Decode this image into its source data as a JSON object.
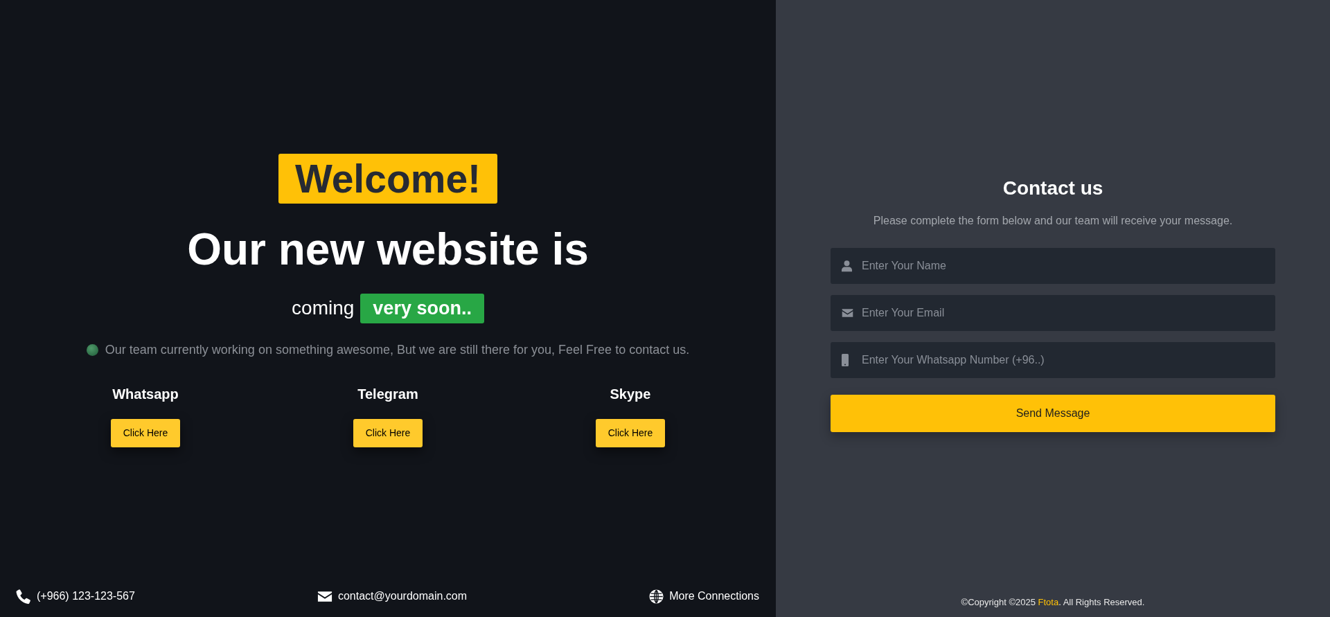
{
  "hero": {
    "badge": "Welcome!",
    "headline": "Our new website is",
    "coming": "coming",
    "soon": "very soon..",
    "description": "Our team currently working on something awesome, But we are still there for you, Feel Free to contact us."
  },
  "socials": [
    {
      "name": "Whatsapp",
      "button": "Click Here"
    },
    {
      "name": "Telegram",
      "button": "Click Here"
    },
    {
      "name": "Skype",
      "button": "Click Here"
    }
  ],
  "footer": [
    {
      "kind": "phone",
      "text": "(+966) 123-123-567"
    },
    {
      "kind": "email",
      "text": "contact@yourdomain.com"
    },
    {
      "kind": "globe",
      "text": "More Connections"
    }
  ],
  "contact": {
    "title": "Contact us",
    "subtitle": "Please complete the form below and our team will receive your message.",
    "fields": [
      {
        "kind": "user",
        "placeholder": "Enter Your Name"
      },
      {
        "kind": "email",
        "placeholder": "Enter Your Email"
      },
      {
        "kind": "mobile",
        "placeholder": "Enter Your Whatsapp Number (+96..)"
      }
    ],
    "submit": "Send Message"
  },
  "copyright": {
    "before": "©Copyright ©2025",
    "link": "Ftota",
    "after": ". All Rights Reserved."
  }
}
